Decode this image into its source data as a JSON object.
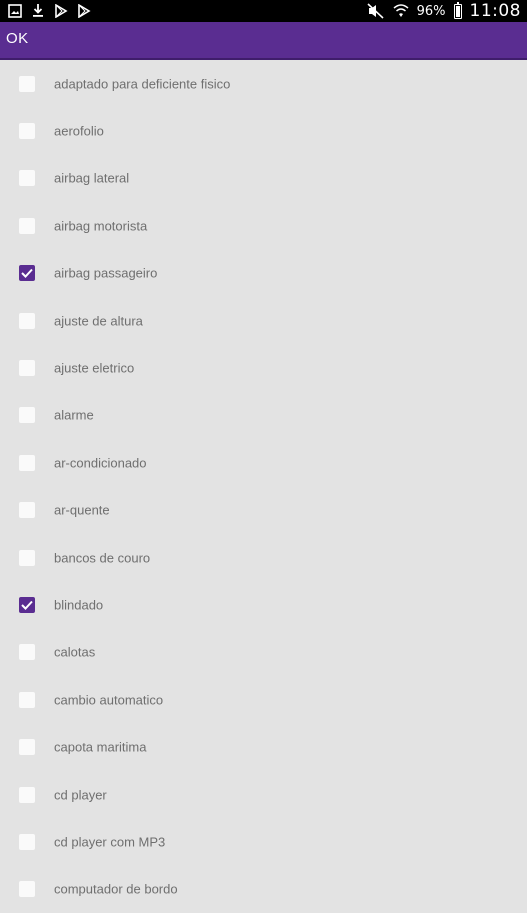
{
  "status_bar": {
    "battery_percent": "96%",
    "time": "11:08",
    "notification_icons": [
      "image-icon",
      "download-icon",
      "play-store-icon",
      "play-store-icon"
    ],
    "system_icons": [
      "mute-icon",
      "wifi-icon",
      "battery-icon"
    ]
  },
  "toolbar": {
    "ok_label": "OK",
    "background_color": "#5a2d91"
  },
  "options": [
    {
      "label": "adaptado para deficiente fisico",
      "checked": false
    },
    {
      "label": "aerofolio",
      "checked": false
    },
    {
      "label": "airbag lateral",
      "checked": false
    },
    {
      "label": "airbag motorista",
      "checked": false
    },
    {
      "label": "airbag passageiro",
      "checked": true
    },
    {
      "label": "ajuste de altura",
      "checked": false
    },
    {
      "label": "ajuste eletrico",
      "checked": false
    },
    {
      "label": "alarme",
      "checked": false
    },
    {
      "label": "ar-condicionado",
      "checked": false
    },
    {
      "label": "ar-quente",
      "checked": false
    },
    {
      "label": "bancos de couro",
      "checked": false
    },
    {
      "label": "blindado",
      "checked": true
    },
    {
      "label": "calotas",
      "checked": false
    },
    {
      "label": "cambio automatico",
      "checked": false
    },
    {
      "label": "capota maritima",
      "checked": false
    },
    {
      "label": "cd player",
      "checked": false
    },
    {
      "label": "cd player com MP3",
      "checked": false
    },
    {
      "label": "computador de bordo",
      "checked": false
    }
  ]
}
